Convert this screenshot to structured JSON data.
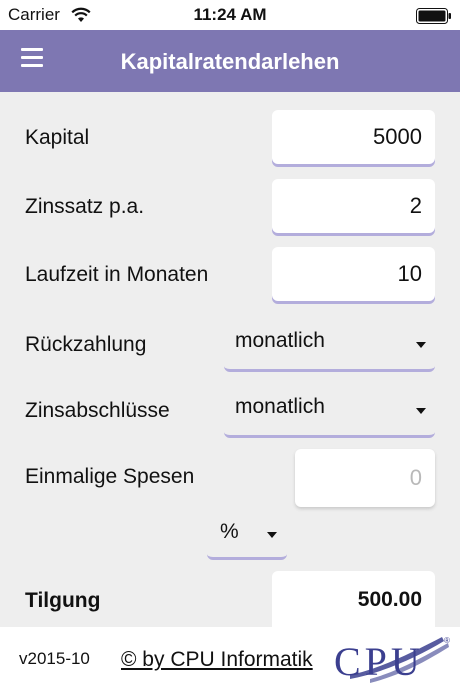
{
  "status": {
    "carrier": "Carrier",
    "time": "11:24 AM"
  },
  "nav": {
    "title": "Kapitalratendarlehen"
  },
  "form": {
    "kapital": {
      "label": "Kapital",
      "value": "5000"
    },
    "zinssatz": {
      "label": "Zinssatz p.a.",
      "value": "2"
    },
    "laufzeit": {
      "label": "Laufzeit in Monaten",
      "value": "10"
    },
    "rueckzahlung": {
      "label": "Rückzahlung",
      "selected": "monatlich"
    },
    "zinsabschluesse": {
      "label": "Zinsabschlüsse",
      "selected": "monatlich"
    },
    "spesen": {
      "label": "Einmalige Spesen",
      "placeholder": "0",
      "unit_selected": "%"
    },
    "tilgung": {
      "label": "Tilgung",
      "value": "500.00"
    }
  },
  "footer": {
    "version": "v2015-10",
    "copyright": "© by CPU Informatik",
    "logo_text": "CPU"
  },
  "colors": {
    "accent": "#7e77b2",
    "underline": "#b3addc",
    "logo": "#3b3f8f"
  }
}
